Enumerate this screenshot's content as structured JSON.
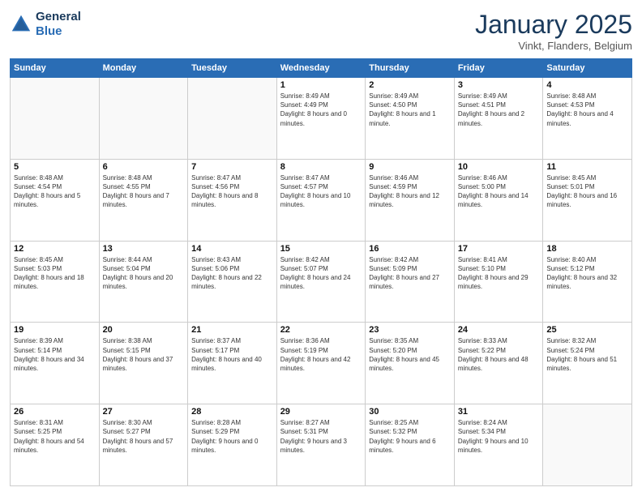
{
  "header": {
    "logo_line1": "General",
    "logo_line2": "Blue",
    "month": "January 2025",
    "location": "Vinkt, Flanders, Belgium"
  },
  "days_of_week": [
    "Sunday",
    "Monday",
    "Tuesday",
    "Wednesday",
    "Thursday",
    "Friday",
    "Saturday"
  ],
  "weeks": [
    [
      {
        "day": "",
        "empty": true
      },
      {
        "day": "",
        "empty": true
      },
      {
        "day": "",
        "empty": true
      },
      {
        "day": "1",
        "sunrise": "8:49 AM",
        "sunset": "4:49 PM",
        "daylight": "8 hours and 0 minutes."
      },
      {
        "day": "2",
        "sunrise": "8:49 AM",
        "sunset": "4:50 PM",
        "daylight": "8 hours and 1 minute."
      },
      {
        "day": "3",
        "sunrise": "8:49 AM",
        "sunset": "4:51 PM",
        "daylight": "8 hours and 2 minutes."
      },
      {
        "day": "4",
        "sunrise": "8:48 AM",
        "sunset": "4:53 PM",
        "daylight": "8 hours and 4 minutes."
      }
    ],
    [
      {
        "day": "5",
        "sunrise": "8:48 AM",
        "sunset": "4:54 PM",
        "daylight": "8 hours and 5 minutes."
      },
      {
        "day": "6",
        "sunrise": "8:48 AM",
        "sunset": "4:55 PM",
        "daylight": "8 hours and 7 minutes."
      },
      {
        "day": "7",
        "sunrise": "8:47 AM",
        "sunset": "4:56 PM",
        "daylight": "8 hours and 8 minutes."
      },
      {
        "day": "8",
        "sunrise": "8:47 AM",
        "sunset": "4:57 PM",
        "daylight": "8 hours and 10 minutes."
      },
      {
        "day": "9",
        "sunrise": "8:46 AM",
        "sunset": "4:59 PM",
        "daylight": "8 hours and 12 minutes."
      },
      {
        "day": "10",
        "sunrise": "8:46 AM",
        "sunset": "5:00 PM",
        "daylight": "8 hours and 14 minutes."
      },
      {
        "day": "11",
        "sunrise": "8:45 AM",
        "sunset": "5:01 PM",
        "daylight": "8 hours and 16 minutes."
      }
    ],
    [
      {
        "day": "12",
        "sunrise": "8:45 AM",
        "sunset": "5:03 PM",
        "daylight": "8 hours and 18 minutes."
      },
      {
        "day": "13",
        "sunrise": "8:44 AM",
        "sunset": "5:04 PM",
        "daylight": "8 hours and 20 minutes."
      },
      {
        "day": "14",
        "sunrise": "8:43 AM",
        "sunset": "5:06 PM",
        "daylight": "8 hours and 22 minutes."
      },
      {
        "day": "15",
        "sunrise": "8:42 AM",
        "sunset": "5:07 PM",
        "daylight": "8 hours and 24 minutes."
      },
      {
        "day": "16",
        "sunrise": "8:42 AM",
        "sunset": "5:09 PM",
        "daylight": "8 hours and 27 minutes."
      },
      {
        "day": "17",
        "sunrise": "8:41 AM",
        "sunset": "5:10 PM",
        "daylight": "8 hours and 29 minutes."
      },
      {
        "day": "18",
        "sunrise": "8:40 AM",
        "sunset": "5:12 PM",
        "daylight": "8 hours and 32 minutes."
      }
    ],
    [
      {
        "day": "19",
        "sunrise": "8:39 AM",
        "sunset": "5:14 PM",
        "daylight": "8 hours and 34 minutes."
      },
      {
        "day": "20",
        "sunrise": "8:38 AM",
        "sunset": "5:15 PM",
        "daylight": "8 hours and 37 minutes."
      },
      {
        "day": "21",
        "sunrise": "8:37 AM",
        "sunset": "5:17 PM",
        "daylight": "8 hours and 40 minutes."
      },
      {
        "day": "22",
        "sunrise": "8:36 AM",
        "sunset": "5:19 PM",
        "daylight": "8 hours and 42 minutes."
      },
      {
        "day": "23",
        "sunrise": "8:35 AM",
        "sunset": "5:20 PM",
        "daylight": "8 hours and 45 minutes."
      },
      {
        "day": "24",
        "sunrise": "8:33 AM",
        "sunset": "5:22 PM",
        "daylight": "8 hours and 48 minutes."
      },
      {
        "day": "25",
        "sunrise": "8:32 AM",
        "sunset": "5:24 PM",
        "daylight": "8 hours and 51 minutes."
      }
    ],
    [
      {
        "day": "26",
        "sunrise": "8:31 AM",
        "sunset": "5:25 PM",
        "daylight": "8 hours and 54 minutes."
      },
      {
        "day": "27",
        "sunrise": "8:30 AM",
        "sunset": "5:27 PM",
        "daylight": "8 hours and 57 minutes."
      },
      {
        "day": "28",
        "sunrise": "8:28 AM",
        "sunset": "5:29 PM",
        "daylight": "9 hours and 0 minutes."
      },
      {
        "day": "29",
        "sunrise": "8:27 AM",
        "sunset": "5:31 PM",
        "daylight": "9 hours and 3 minutes."
      },
      {
        "day": "30",
        "sunrise": "8:25 AM",
        "sunset": "5:32 PM",
        "daylight": "9 hours and 6 minutes."
      },
      {
        "day": "31",
        "sunrise": "8:24 AM",
        "sunset": "5:34 PM",
        "daylight": "9 hours and 10 minutes."
      },
      {
        "day": "",
        "empty": true
      }
    ]
  ]
}
